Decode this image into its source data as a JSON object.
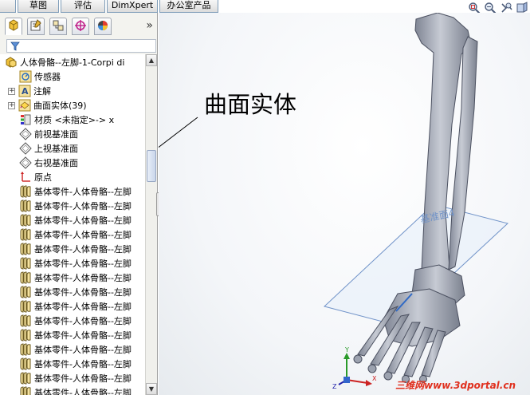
{
  "command_tabs": [
    "",
    "草图",
    "评估",
    "DimXpert",
    "办公室产品"
  ],
  "view_toolbar": {
    "icons": [
      "zoom-to-fit-icon",
      "zoom-area-icon",
      "previous-view-icon",
      "section-view-icon"
    ]
  },
  "panel": {
    "tabs": [
      "feature-manager-icon",
      "property-manager-icon",
      "configuration-manager-icon",
      "dimxpert-manager-icon",
      "display-manager-icon"
    ],
    "expand_glyph": "»"
  },
  "tree": {
    "root": "人体骨骼--左脚-1-Corpi di",
    "items": [
      {
        "label": "传感器",
        "icon": "sensor-icon",
        "expandable": false
      },
      {
        "label": "注解",
        "icon": "annotation-icon",
        "expandable": true
      },
      {
        "label": "曲面实体(39)",
        "icon": "surface-bodies-icon",
        "expandable": true
      },
      {
        "label": "材质 <未指定>-> x",
        "icon": "material-icon",
        "expandable": false
      },
      {
        "label": "前视基准面",
        "icon": "plane-icon",
        "expandable": false
      },
      {
        "label": "上视基准面",
        "icon": "plane-icon",
        "expandable": false
      },
      {
        "label": "右视基准面",
        "icon": "plane-icon",
        "expandable": false
      },
      {
        "label": "原点",
        "icon": "origin-icon",
        "expandable": false
      },
      {
        "label": "基体零件-人体骨骼--左脚",
        "icon": "base-part-icon",
        "expandable": false
      },
      {
        "label": "基体零件-人体骨骼--左脚",
        "icon": "base-part-icon",
        "expandable": false
      },
      {
        "label": "基体零件-人体骨骼--左脚",
        "icon": "base-part-icon",
        "expandable": false
      },
      {
        "label": "基体零件-人体骨骼--左脚",
        "icon": "base-part-icon",
        "expandable": false
      },
      {
        "label": "基体零件-人体骨骼--左脚",
        "icon": "base-part-icon",
        "expandable": false
      },
      {
        "label": "基体零件-人体骨骼--左脚",
        "icon": "base-part-icon",
        "expandable": false
      },
      {
        "label": "基体零件-人体骨骼--左脚",
        "icon": "base-part-icon",
        "expandable": false
      },
      {
        "label": "基体零件-人体骨骼--左脚",
        "icon": "base-part-icon",
        "expandable": false
      },
      {
        "label": "基体零件-人体骨骼--左脚",
        "icon": "base-part-icon",
        "expandable": false
      },
      {
        "label": "基体零件-人体骨骼--左脚",
        "icon": "base-part-icon",
        "expandable": false
      },
      {
        "label": "基体零件-人体骨骼--左脚",
        "icon": "base-part-icon",
        "expandable": false
      },
      {
        "label": "基体零件-人体骨骼--左脚",
        "icon": "base-part-icon",
        "expandable": false
      },
      {
        "label": "基体零件-人体骨骼--左脚",
        "icon": "base-part-icon",
        "expandable": false
      },
      {
        "label": "基体零件-人体骨骼--左脚",
        "icon": "base-part-icon",
        "expandable": false
      },
      {
        "label": "基体零件-人体骨骼--左脚",
        "icon": "base-part-icon",
        "expandable": false
      },
      {
        "label": "基体零件-人体骨骼--左脚",
        "icon": "base-part-icon",
        "expandable": false
      }
    ]
  },
  "viewport": {
    "callout_text": "曲面实体",
    "plane_label": "基准面4",
    "triad_axes": [
      "Y",
      "X",
      "Z"
    ],
    "watermark": "三维网www.3dportal.cn"
  },
  "colors": {
    "bone_fill": "#9aa0ad",
    "plane_edge": "#6f92c8",
    "selection_blue": "#316ac5"
  }
}
